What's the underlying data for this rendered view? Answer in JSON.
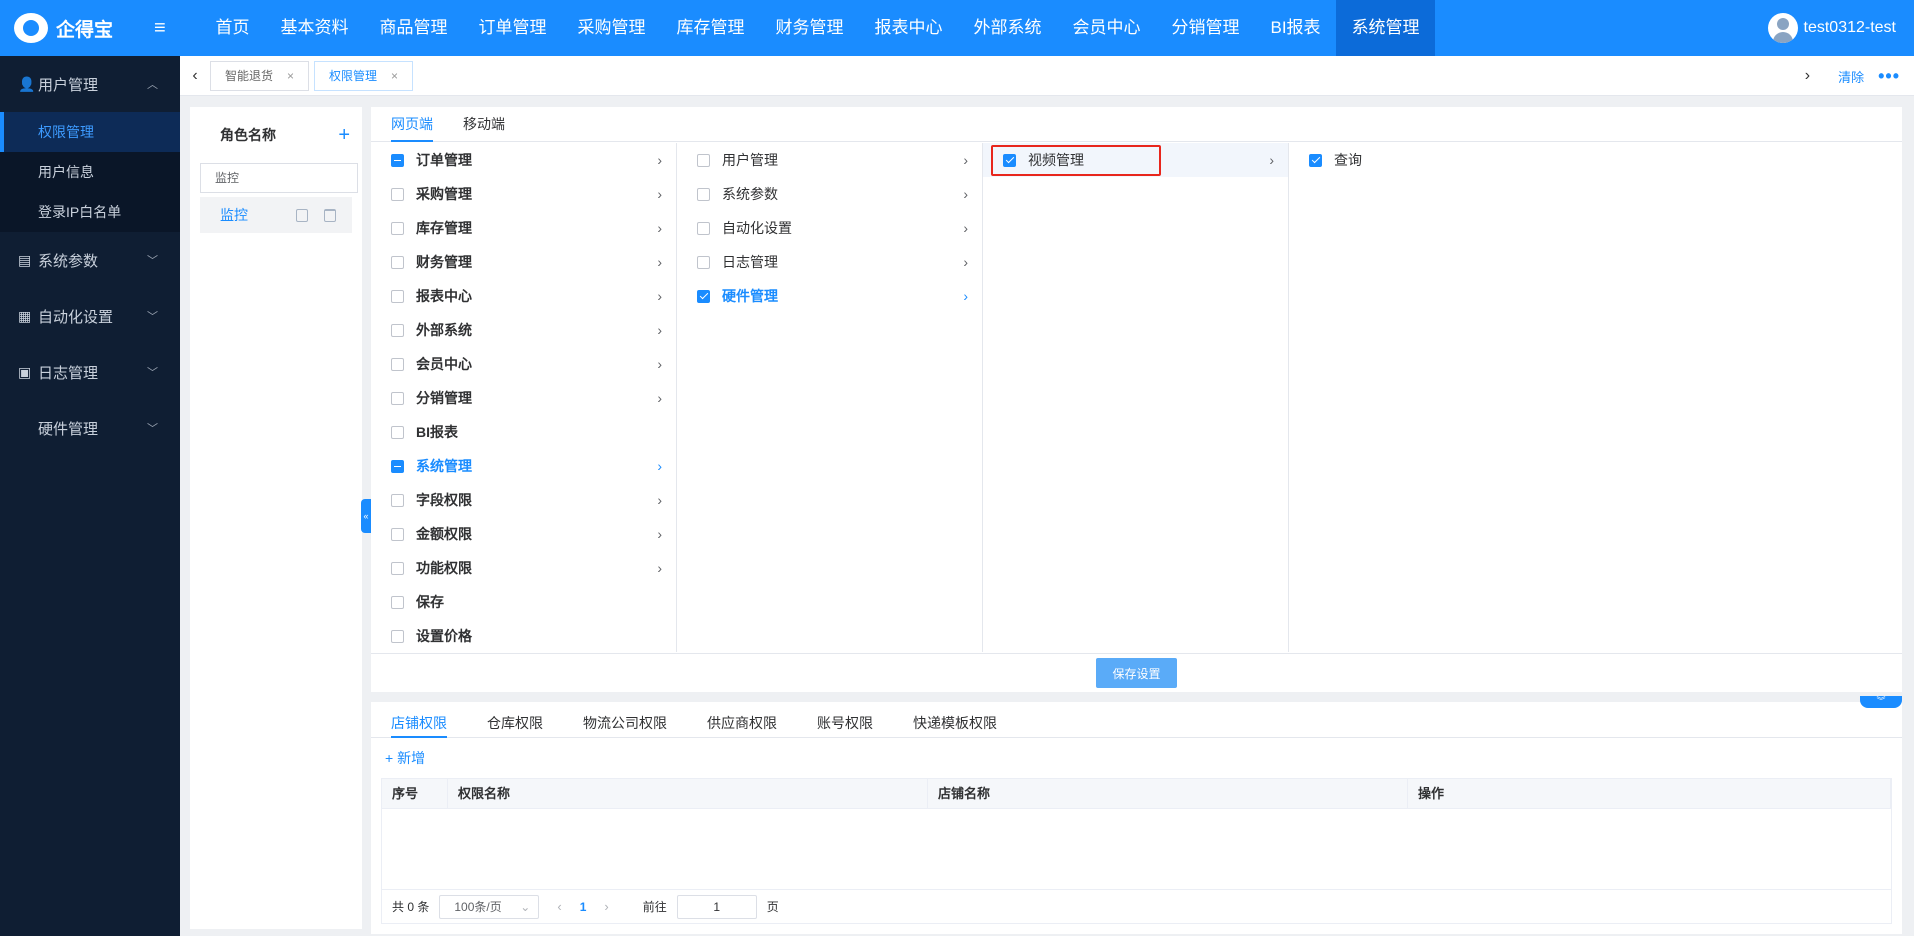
{
  "brand": {
    "name": "企得宝"
  },
  "topnav": [
    {
      "label": "首页",
      "name": "nav-home"
    },
    {
      "label": "基本资料",
      "name": "nav-basic-data"
    },
    {
      "label": "商品管理",
      "name": "nav-product"
    },
    {
      "label": "订单管理",
      "name": "nav-order"
    },
    {
      "label": "采购管理",
      "name": "nav-purchase"
    },
    {
      "label": "库存管理",
      "name": "nav-inventory"
    },
    {
      "label": "财务管理",
      "name": "nav-finance"
    },
    {
      "label": "报表中心",
      "name": "nav-report"
    },
    {
      "label": "外部系统",
      "name": "nav-external"
    },
    {
      "label": "会员中心",
      "name": "nav-member"
    },
    {
      "label": "分销管理",
      "name": "nav-distribution"
    },
    {
      "label": "BI报表",
      "name": "nav-bi"
    },
    {
      "label": "系统管理",
      "name": "nav-system",
      "active": true
    }
  ],
  "user": {
    "name": "test0312-test"
  },
  "sidebar": {
    "groups": [
      {
        "label": "用户管理",
        "icon": "user-icon",
        "expanded": true,
        "items": [
          {
            "label": "权限管理",
            "active": true
          },
          {
            "label": "用户信息"
          },
          {
            "label": "登录IP白名单"
          }
        ]
      },
      {
        "label": "系统参数",
        "icon": "doc-icon"
      },
      {
        "label": "自动化设置",
        "icon": "list-icon"
      },
      {
        "label": "日志管理",
        "icon": "calendar-icon"
      },
      {
        "label": "硬件管理",
        "icon": ""
      }
    ]
  },
  "page_tabs": [
    {
      "label": "智能退货",
      "active": false
    },
    {
      "label": "权限管理",
      "active": true
    }
  ],
  "tab_actions": {
    "clear": "清除",
    "more": "•••"
  },
  "roles": {
    "header": "角色名称",
    "search_value": "监控",
    "items": [
      {
        "label": "监控"
      }
    ]
  },
  "perm_tabs": [
    {
      "label": "网页端",
      "active": true
    },
    {
      "label": "移动端",
      "active": false
    }
  ],
  "perm_columns": [
    [
      {
        "label": "订单管理",
        "state": "partial",
        "arrow": true
      },
      {
        "label": "采购管理",
        "state": "none",
        "arrow": true
      },
      {
        "label": "库存管理",
        "state": "none",
        "arrow": true
      },
      {
        "label": "财务管理",
        "state": "none",
        "arrow": true
      },
      {
        "label": "报表中心",
        "state": "none",
        "arrow": true
      },
      {
        "label": "外部系统",
        "state": "none",
        "arrow": true
      },
      {
        "label": "会员中心",
        "state": "none",
        "arrow": true
      },
      {
        "label": "分销管理",
        "state": "none",
        "arrow": true
      },
      {
        "label": "BI报表",
        "state": "none",
        "arrow": false
      },
      {
        "label": "系统管理",
        "state": "partial",
        "arrow": true,
        "selected": true
      },
      {
        "label": "字段权限",
        "state": "none",
        "arrow": true
      },
      {
        "label": "金额权限",
        "state": "none",
        "arrow": true
      },
      {
        "label": "功能权限",
        "state": "none",
        "arrow": true
      },
      {
        "label": "保存",
        "state": "none",
        "arrow": false
      },
      {
        "label": "设置价格",
        "state": "none",
        "arrow": false
      }
    ],
    [
      {
        "label": "用户管理",
        "state": "none",
        "arrow": true
      },
      {
        "label": "系统参数",
        "state": "none",
        "arrow": true
      },
      {
        "label": "自动化设置",
        "state": "none",
        "arrow": true
      },
      {
        "label": "日志管理",
        "state": "none",
        "arrow": true
      },
      {
        "label": "硬件管理",
        "state": "checked",
        "arrow": true,
        "selected": true
      }
    ],
    [
      {
        "label": "视频管理",
        "state": "checked",
        "arrow": true,
        "highlight": true
      }
    ],
    [
      {
        "label": "查询",
        "state": "checked",
        "arrow": false
      }
    ]
  ],
  "save_button": "保存设置",
  "bottom_tabs": [
    {
      "label": "店铺权限",
      "active": true
    },
    {
      "label": "仓库权限"
    },
    {
      "label": "物流公司权限"
    },
    {
      "label": "供应商权限"
    },
    {
      "label": "账号权限"
    },
    {
      "label": "快递模板权限"
    }
  ],
  "add_label": "+ 新增",
  "table": {
    "columns": [
      "序号",
      "权限名称",
      "店铺名称",
      "操作"
    ],
    "rows": []
  },
  "pager": {
    "total": "共 0 条",
    "page_size": "100条/页",
    "current_page": "1",
    "goto_label": "前往",
    "goto_value": "1",
    "page_suffix": "页"
  }
}
